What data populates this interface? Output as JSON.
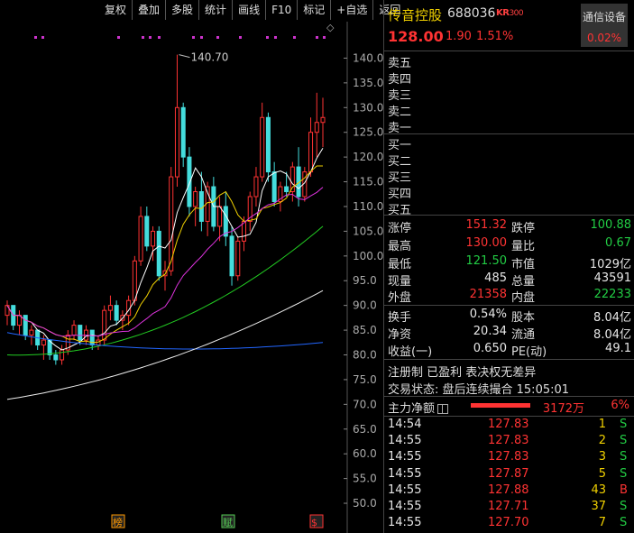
{
  "toolbar": [
    "复权",
    "叠加",
    "多股",
    "统计",
    "画线",
    "F10",
    "标记",
    "+自选",
    "返回"
  ],
  "stock": {
    "name": "传音控股",
    "code": "688036",
    "tag_kr": "KR",
    "tag_num": "300",
    "price": "128.00",
    "change": "1.90",
    "change_pct": "1.51%"
  },
  "sector": {
    "name": "通信设备",
    "pct": "0.02%"
  },
  "order_book": {
    "sell": [
      "卖五",
      "卖四",
      "卖三",
      "卖二",
      "卖一"
    ],
    "buy": [
      "买一",
      "买二",
      "买三",
      "买四",
      "买五"
    ]
  },
  "stats": [
    [
      {
        "label": "涨停",
        "value": "151.32",
        "color": "red"
      },
      {
        "label": "跌停",
        "value": "100.88",
        "color": "green"
      }
    ],
    [
      {
        "label": "最高",
        "value": "130.00",
        "color": "red"
      },
      {
        "label": "量比",
        "value": "0.67",
        "color": "green"
      }
    ],
    [
      {
        "label": "最低",
        "value": "121.50",
        "color": "green"
      },
      {
        "label": "市值",
        "value": "1029亿",
        "color": "white"
      }
    ],
    [
      {
        "label": "现量",
        "value": "485",
        "color": "white"
      },
      {
        "label": "总量",
        "value": "43591",
        "color": "white"
      }
    ],
    [
      {
        "label": "外盘",
        "value": "21358",
        "color": "red"
      },
      {
        "label": "内盘",
        "value": "22233",
        "color": "green"
      }
    ],
    [
      {
        "label": "换手",
        "value": "0.54%",
        "color": "white"
      },
      {
        "label": "股本",
        "value": "8.04亿",
        "color": "white"
      }
    ],
    [
      {
        "label": "净资",
        "value": "20.34",
        "color": "white"
      },
      {
        "label": "流通",
        "value": "8.04亿",
        "color": "white"
      }
    ],
    [
      {
        "label": "收益(一)",
        "value": "0.650",
        "color": "white"
      },
      {
        "label": "PE(动)",
        "value": "49.1",
        "color": "white"
      }
    ]
  ],
  "info_line1": "注册制 已盈利 表决权无差异",
  "info_line2": "交易状态: 盘后连续撮合 15:05:01",
  "money_flow": {
    "label": "主力净额",
    "value": "3172万",
    "pct": "6%"
  },
  "ticks": [
    {
      "time": "14:54",
      "price": "127.83",
      "vol": "1",
      "side": "S"
    },
    {
      "time": "14:55",
      "price": "127.83",
      "vol": "2",
      "side": "S"
    },
    {
      "time": "14:55",
      "price": "127.83",
      "vol": "3",
      "side": "S"
    },
    {
      "time": "14:55",
      "price": "127.87",
      "vol": "5",
      "side": "S"
    },
    {
      "time": "14:55",
      "price": "127.88",
      "vol": "43",
      "side": "B"
    },
    {
      "time": "14:55",
      "price": "127.71",
      "vol": "37",
      "side": "S"
    },
    {
      "time": "14:55",
      "price": "127.70",
      "vol": "7",
      "side": "S"
    }
  ],
  "chart_data": {
    "type": "candlestick",
    "y_axis_labels": [
      "140.0",
      "135.0",
      "130.0",
      "125.0",
      "120.0",
      "115.0",
      "110.0",
      "105.0",
      "100.0",
      "95.0",
      "90.0",
      "85.0",
      "80.0",
      "75.0",
      "70.0",
      "65.0",
      "60.0",
      "55.0",
      "50.0"
    ],
    "ylim": [
      48,
      143
    ],
    "peak_label": "140.70",
    "peak_value": 140.7,
    "bottom_markers": [
      "榜",
      "赋",
      "$"
    ],
    "bottom_marker_colors": [
      "#ff9900",
      "#55cc55",
      "#ff3333"
    ],
    "colors": {
      "up": "#ff3333",
      "down": "#44dddd",
      "ma5": "#ffffff",
      "ma10": "#f0d000",
      "ma20": "#dd33dd",
      "ma60": "#22cc22",
      "ma120": "#2266ff",
      "ma250": "#eeeeee"
    },
    "candles": [
      [
        88,
        91,
        86,
        90
      ],
      [
        90,
        90,
        85,
        86
      ],
      [
        86,
        89,
        84,
        88
      ],
      [
        88,
        88,
        83,
        84
      ],
      [
        84,
        86,
        82,
        85
      ],
      [
        85,
        85,
        81,
        82
      ],
      [
        82,
        84,
        79,
        83
      ],
      [
        83,
        83,
        79,
        80
      ],
      [
        80,
        81,
        78,
        79
      ],
      [
        79,
        82,
        78,
        81
      ],
      [
        81,
        85,
        80,
        84
      ],
      [
        84,
        87,
        83,
        86
      ],
      [
        86,
        86,
        82,
        83
      ],
      [
        83,
        86,
        82,
        85
      ],
      [
        85,
        85,
        81,
        82
      ],
      [
        82,
        84,
        81,
        83
      ],
      [
        83,
        90,
        82,
        89
      ],
      [
        89,
        92,
        87,
        90
      ],
      [
        90,
        91,
        86,
        87
      ],
      [
        87,
        89,
        85,
        88
      ],
      [
        88,
        92,
        86,
        91
      ],
      [
        91,
        100,
        90,
        99
      ],
      [
        99,
        110,
        98,
        108
      ],
      [
        108,
        110,
        101,
        102
      ],
      [
        102,
        106,
        99,
        105
      ],
      [
        105,
        106,
        95,
        96
      ],
      [
        96,
        99,
        93,
        97
      ],
      [
        97,
        118,
        96,
        116
      ],
      [
        116,
        140.7,
        114,
        130
      ],
      [
        130,
        131,
        118,
        120
      ],
      [
        120,
        122,
        108,
        110
      ],
      [
        110,
        114,
        106,
        113
      ],
      [
        113,
        117,
        105,
        107
      ],
      [
        107,
        115,
        104,
        114
      ],
      [
        114,
        116,
        105,
        106
      ],
      [
        106,
        112,
        103,
        110
      ],
      [
        110,
        113,
        102,
        104
      ],
      [
        104,
        106,
        94,
        96
      ],
      [
        96,
        104,
        95,
        103
      ],
      [
        103,
        108,
        101,
        107
      ],
      [
        107,
        113,
        105,
        112
      ],
      [
        112,
        118,
        110,
        116
      ],
      [
        116,
        131,
        115,
        128
      ],
      [
        128,
        129,
        115,
        117
      ],
      [
        117,
        119,
        110,
        111
      ],
      [
        111,
        115,
        109,
        114
      ],
      [
        114,
        117,
        112,
        113
      ],
      [
        113,
        119,
        111,
        118
      ],
      [
        118,
        122,
        110,
        112
      ],
      [
        112,
        118,
        111,
        117
      ],
      [
        117,
        128,
        116,
        125
      ],
      [
        125,
        133,
        120,
        127
      ],
      [
        127,
        132,
        122,
        128
      ]
    ]
  }
}
